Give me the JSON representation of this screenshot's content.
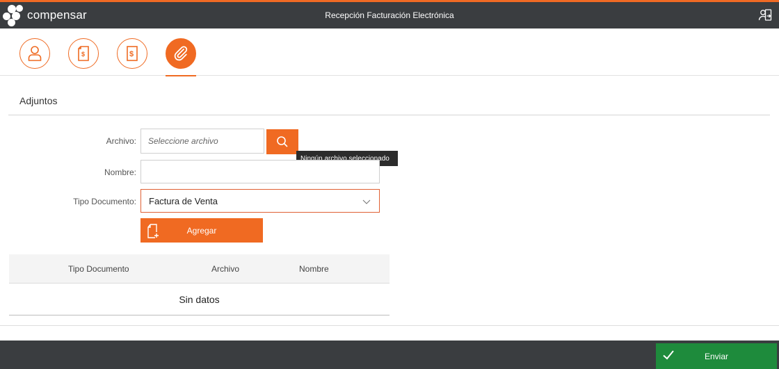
{
  "header": {
    "logo_text": "compensar",
    "title": "Recepción Facturación Electrónica",
    "user_icon": "user-exit-icon"
  },
  "steps": [
    {
      "icon": "user-icon",
      "active": false
    },
    {
      "icon": "invoice-document-icon",
      "active": false
    },
    {
      "icon": "dollar-icon",
      "active": false
    },
    {
      "icon": "paperclip-icon",
      "active": true
    }
  ],
  "section": {
    "title": "Adjuntos"
  },
  "form": {
    "archivo_label": "Archivo:",
    "archivo_placeholder": "Seleccione archivo",
    "tooltip": "Ningún archivo seleccionado",
    "nombre_label": "Nombre:",
    "nombre_value": "",
    "tipo_label": "Tipo Documento:",
    "tipo_value": "Factura de Venta",
    "add_label": "Agregar"
  },
  "table": {
    "columns": [
      "Tipo Documento",
      "Archivo",
      "Nombre"
    ],
    "empty_text": "Sin datos"
  },
  "footer": {
    "send_label": "Enviar"
  },
  "colors": {
    "accent": "#f06a22",
    "header_bg": "#3a3d40",
    "send_bg": "#1e8b3c"
  }
}
